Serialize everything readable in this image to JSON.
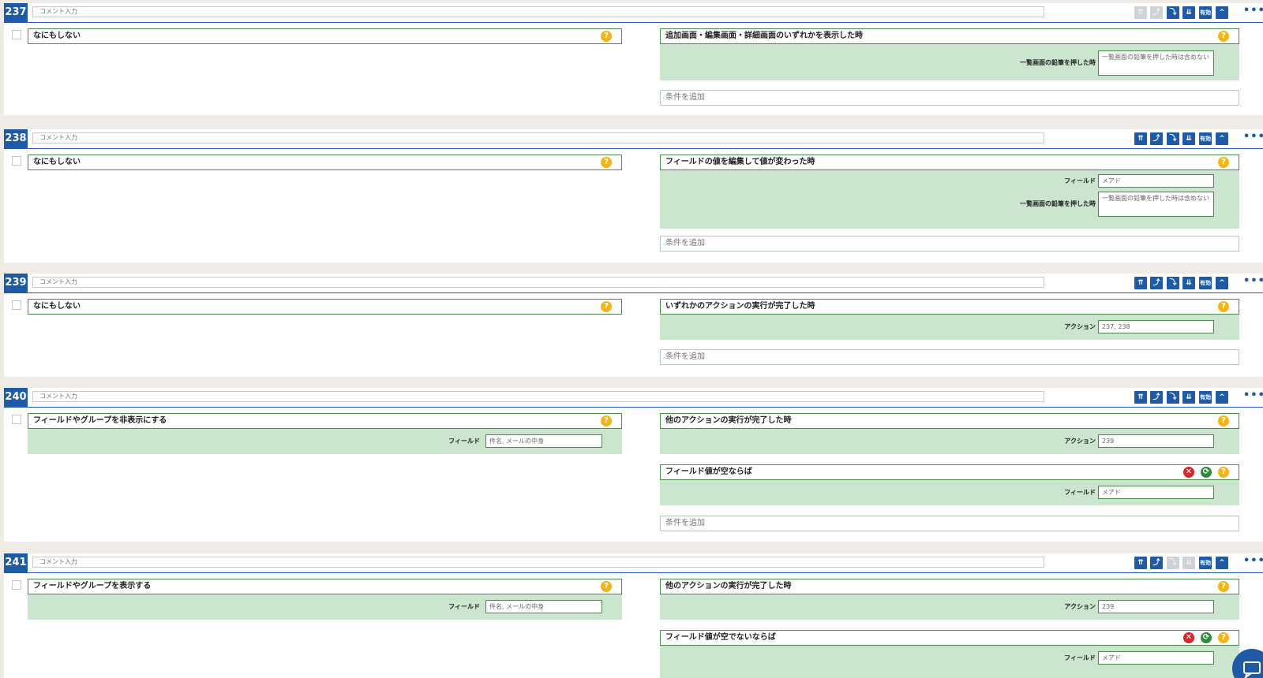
{
  "comment_placeholder": "コメント入力",
  "help_glyph": "?",
  "delete_glyph": "✕",
  "refresh_glyph": "⟳",
  "more_glyph": "•••",
  "toolbar": {
    "move_top": "⇈",
    "move_up": "⤴",
    "move_down": "⤵",
    "move_bottom": "⇊",
    "enabled": "有効",
    "collapse": "^"
  },
  "add_condition": "条件を追加",
  "colors": {
    "accent": "#1e5aa6",
    "panel": "#cbe5cf",
    "help": "#f3b417",
    "delete": "#d8262c",
    "refresh": "#2e8b3c",
    "disabled": "#cfd3d8"
  },
  "rules": [
    {
      "number": "237",
      "toolbar_disabled": [
        "move_top",
        "move_up"
      ],
      "action": {
        "label": "なにもしない",
        "params": []
      },
      "trigger": {
        "label": "追加画面・編集画面・詳細画面のいずれかを表示した時",
        "params": [
          {
            "label": "一覧画面の鉛筆を押した時",
            "value": "一覧画面の鉛筆を押した時は含めない"
          }
        ]
      },
      "conditions": []
    },
    {
      "number": "238",
      "toolbar_disabled": [],
      "action": {
        "label": "なにもしない",
        "params": []
      },
      "trigger": {
        "label": "フィールドの値を編集して値が変わった時",
        "params": [
          {
            "label": "フィールド",
            "value": "メアド"
          },
          {
            "label": "一覧画面の鉛筆を押した時",
            "value": "一覧画面の鉛筆を押した時は含めない"
          }
        ]
      },
      "conditions": []
    },
    {
      "number": "239",
      "toolbar_disabled": [],
      "action": {
        "label": "なにもしない",
        "params": []
      },
      "trigger": {
        "label": "いずれかのアクションの実行が完了した時",
        "params": [
          {
            "label": "アクション",
            "value": "237, 238"
          }
        ]
      },
      "conditions": []
    },
    {
      "number": "240",
      "toolbar_disabled": [],
      "action": {
        "label": "フィールドやグループを非表示にする",
        "params": [
          {
            "label": "フィールド",
            "value": "件名, メールの中身"
          }
        ]
      },
      "trigger": {
        "label": "他のアクションの実行が完了した時",
        "params": [
          {
            "label": "アクション",
            "value": "239"
          }
        ]
      },
      "conditions": [
        {
          "label": "フィールド値が空ならば",
          "params": [
            {
              "label": "フィールド",
              "value": "メアド"
            }
          ]
        }
      ]
    },
    {
      "number": "241",
      "toolbar_disabled": [
        "move_down",
        "move_bottom"
      ],
      "action": {
        "label": "フィールドやグループを表示する",
        "params": [
          {
            "label": "フィールド",
            "value": "件名, メールの中身"
          }
        ]
      },
      "trigger": {
        "label": "他のアクションの実行が完了した時",
        "params": [
          {
            "label": "アクション",
            "value": "239"
          }
        ]
      },
      "conditions": [
        {
          "label": "フィールド値が空でないならば",
          "params": [
            {
              "label": "フィールド",
              "value": "メアド"
            }
          ]
        }
      ]
    }
  ]
}
